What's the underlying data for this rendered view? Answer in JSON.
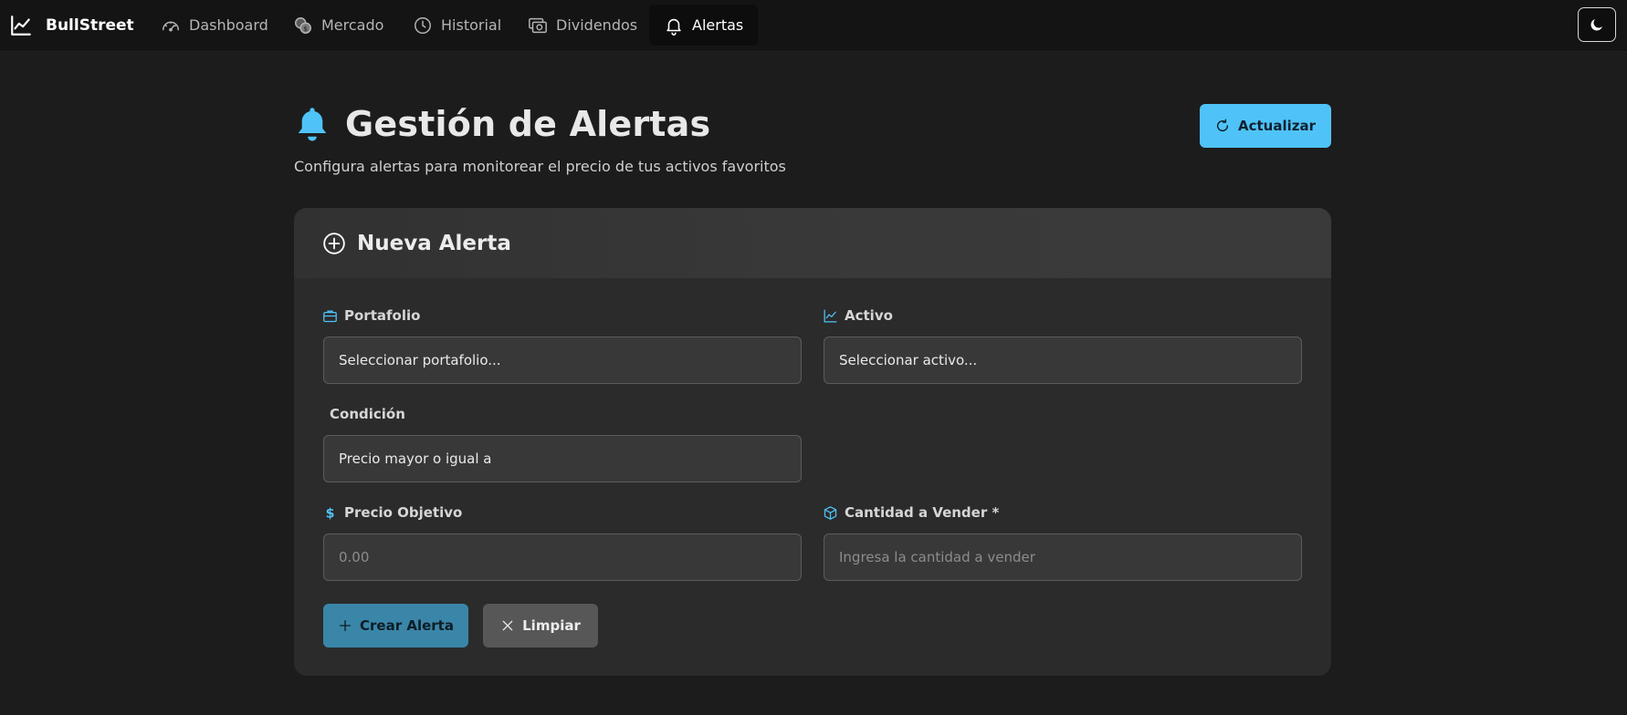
{
  "navbar": {
    "brand": "BullStreet",
    "items": [
      {
        "label": "Dashboard",
        "icon": "gauge-icon"
      },
      {
        "label": "Mercado",
        "icon": "coins-icon"
      },
      {
        "label": "Historial",
        "icon": "clock-icon"
      },
      {
        "label": "Dividendos",
        "icon": "cash-icon"
      },
      {
        "label": "Alertas",
        "icon": "bell-icon",
        "active": true
      }
    ],
    "theme_toggle_icon": "moon-icon"
  },
  "header": {
    "title": "Gestión de Alertas",
    "subtitle": "Configura alertas para monitorear el precio de tus activos favoritos",
    "refresh_label": "Actualizar"
  },
  "form": {
    "title": "Nueva Alerta",
    "portfolio": {
      "label": "Portafolio",
      "value": "Seleccionar portafolio..."
    },
    "asset": {
      "label": "Activo",
      "value": "Seleccionar activo..."
    },
    "condition": {
      "label": "Condición",
      "value": "Precio mayor o igual a"
    },
    "target_price": {
      "label": "Precio Objetivo",
      "placeholder": "0.00"
    },
    "quantity": {
      "label": "Cantidad a Vender *",
      "placeholder": "Ingresa la cantidad a vender"
    },
    "create_label": "Crear Alerta",
    "clear_label": "Limpiar"
  },
  "colors": {
    "accent": "#4fc3f7",
    "background": "#1c1c1c",
    "card": "#2b2b2b",
    "create_button": "#3a86a8",
    "clear_button": "#575757"
  }
}
